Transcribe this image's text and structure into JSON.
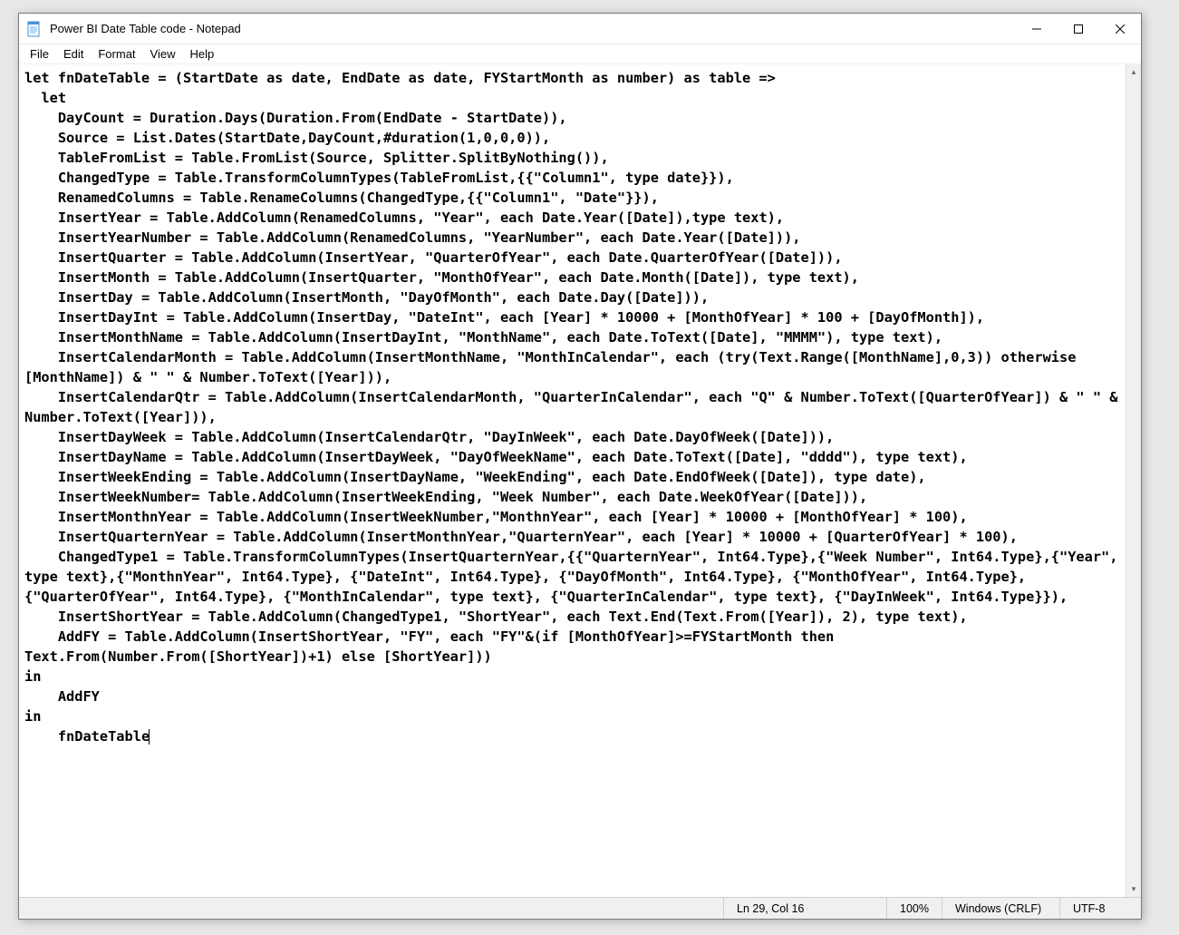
{
  "titlebar": {
    "title": "Power BI Date Table code - Notepad"
  },
  "menubar": {
    "file": "File",
    "edit": "Edit",
    "format": "Format",
    "view": "View",
    "help": "Help"
  },
  "editor": {
    "text": "let fnDateTable = (StartDate as date, EndDate as date, FYStartMonth as number) as table =>\n  let\n    DayCount = Duration.Days(Duration.From(EndDate - StartDate)),\n    Source = List.Dates(StartDate,DayCount,#duration(1,0,0,0)),\n    TableFromList = Table.FromList(Source, Splitter.SplitByNothing()),\n    ChangedType = Table.TransformColumnTypes(TableFromList,{{\"Column1\", type date}}),\n    RenamedColumns = Table.RenameColumns(ChangedType,{{\"Column1\", \"Date\"}}),\n    InsertYear = Table.AddColumn(RenamedColumns, \"Year\", each Date.Year([Date]),type text),\n    InsertYearNumber = Table.AddColumn(RenamedColumns, \"YearNumber\", each Date.Year([Date])),\n    InsertQuarter = Table.AddColumn(InsertYear, \"QuarterOfYear\", each Date.QuarterOfYear([Date])),\n    InsertMonth = Table.AddColumn(InsertQuarter, \"MonthOfYear\", each Date.Month([Date]), type text),\n    InsertDay = Table.AddColumn(InsertMonth, \"DayOfMonth\", each Date.Day([Date])),\n    InsertDayInt = Table.AddColumn(InsertDay, \"DateInt\", each [Year] * 10000 + [MonthOfYear] * 100 + [DayOfMonth]),\n    InsertMonthName = Table.AddColumn(InsertDayInt, \"MonthName\", each Date.ToText([Date], \"MMMM\"), type text),\n    InsertCalendarMonth = Table.AddColumn(InsertMonthName, \"MonthInCalendar\", each (try(Text.Range([MonthName],0,3)) otherwise [MonthName]) & \" \" & Number.ToText([Year])),\n    InsertCalendarQtr = Table.AddColumn(InsertCalendarMonth, \"QuarterInCalendar\", each \"Q\" & Number.ToText([QuarterOfYear]) & \" \" & Number.ToText([Year])),\n    InsertDayWeek = Table.AddColumn(InsertCalendarQtr, \"DayInWeek\", each Date.DayOfWeek([Date])),\n    InsertDayName = Table.AddColumn(InsertDayWeek, \"DayOfWeekName\", each Date.ToText([Date], \"dddd\"), type text),\n    InsertWeekEnding = Table.AddColumn(InsertDayName, \"WeekEnding\", each Date.EndOfWeek([Date]), type date),\n    InsertWeekNumber= Table.AddColumn(InsertWeekEnding, \"Week Number\", each Date.WeekOfYear([Date])),\n    InsertMonthnYear = Table.AddColumn(InsertWeekNumber,\"MonthnYear\", each [Year] * 10000 + [MonthOfYear] * 100),\n    InsertQuarternYear = Table.AddColumn(InsertMonthnYear,\"QuarternYear\", each [Year] * 10000 + [QuarterOfYear] * 100),\n    ChangedType1 = Table.TransformColumnTypes(InsertQuarternYear,{{\"QuarternYear\", Int64.Type},{\"Week Number\", Int64.Type},{\"Year\", type text},{\"MonthnYear\", Int64.Type}, {\"DateInt\", Int64.Type}, {\"DayOfMonth\", Int64.Type}, {\"MonthOfYear\", Int64.Type}, {\"QuarterOfYear\", Int64.Type}, {\"MonthInCalendar\", type text}, {\"QuarterInCalendar\", type text}, {\"DayInWeek\", Int64.Type}}),\n    InsertShortYear = Table.AddColumn(ChangedType1, \"ShortYear\", each Text.End(Text.From([Year]), 2), type text),\n    AddFY = Table.AddColumn(InsertShortYear, \"FY\", each \"FY\"&(if [MonthOfYear]>=FYStartMonth then Text.From(Number.From([ShortYear])+1) else [ShortYear]))\nin\n    AddFY\nin\n    fnDateTable"
  },
  "statusbar": {
    "position": "Ln 29, Col 16",
    "zoom": "100%",
    "lineending": "Windows (CRLF)",
    "encoding": "UTF-8"
  }
}
